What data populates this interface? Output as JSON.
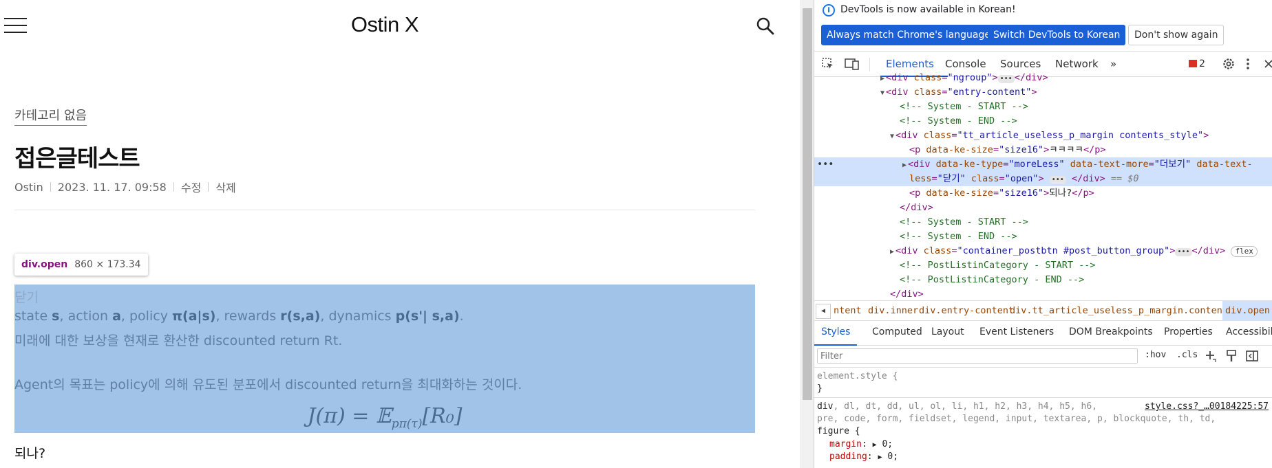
{
  "blog": {
    "site_title": "Ostin X",
    "category": "카테고리 없음",
    "post_title": "접은글테스트",
    "author": "Ostin",
    "date": "2023. 11. 17. 09:58",
    "edit_label": "수정",
    "delete_label": "삭제",
    "tooltip": {
      "selector": "div.open",
      "size": "860 × 173.34"
    },
    "content": {
      "close_label": "닫기",
      "line1_parts": [
        "state ",
        "s",
        ", action ",
        "a",
        ", policy ",
        "π(a|s)",
        ", rewards ",
        "r(s,a)",
        ", dynamics ",
        "p(s'| s,a)",
        "."
      ],
      "line2": "미래에 대한 보상을 현재로 환산한 discounted return Rt.",
      "line3": "Agent의 목표는 policy에 의해 유도된 분포에서 discounted return을 최대화하는 것이다.",
      "formula_left": "J(π) = 𝔼",
      "formula_sub": "pπ(τ)",
      "formula_right": "[R₀]"
    },
    "after_text": "되나?"
  },
  "devtools": {
    "info_text": "DevTools is now available in Korean!",
    "btn_match": "Always match Chrome's language",
    "btn_switch": "Switch DevTools to Korean",
    "btn_dismiss": "Don't show again",
    "tabs": [
      "Elements",
      "Console",
      "Sources",
      "Network"
    ],
    "more_tabs": "»",
    "error_count": "2",
    "dom": {
      "r0_attr": "class",
      "r0_val": "\"ngroup\"",
      "r1_val": "\"entry-content\"",
      "c_start": "<!-- System - START -->",
      "c_end": "<!-- System - END -->",
      "r4_val": "\"tt_article_useless_p_margin contents_style\"",
      "r5_val": "\"size16\"",
      "r5_text": "ㅋㅋㅋㅋ",
      "sel_a1": "data-ke-type",
      "sel_v1": "\"moreLess\"",
      "sel_a2": "data-text-more",
      "sel_v2": "\"더보기\"",
      "sel_a3": "data-text-",
      "sel_a3b": "less",
      "sel_v3": "\"닫기\"",
      "sel_a4": "class",
      "sel_v4": "\"open\"",
      "sel_dollar": "== $0",
      "r7_text": "되나?",
      "r11_val": "\"container_postbtn #post_button_group\"",
      "flex": "flex",
      "c_plc_start": "<!-- PostListinCategory - START -->",
      "c_plc_end": "<!-- PostListinCategory - END -->"
    },
    "breadcrumbs": [
      "ntent",
      "div.inner",
      "div.entry-content",
      "div.tt_article_useless_p_margin.contents_style",
      "div.open"
    ],
    "subtabs": [
      "Styles",
      "Computed",
      "Layout",
      "Event Listeners",
      "DOM Breakpoints",
      "Properties",
      "Accessibility"
    ],
    "filter_placeholder": "Filter",
    "hov": ":hov",
    "cls": ".cls",
    "styles": {
      "element_style": "element.style {",
      "close_brace": "}",
      "selector_line1": "div, dl, dt, dd, ul, ol, li, h1, h2, h3, h4, h5, h6,",
      "selector_line2": "pre, code, form, fieldset, legend, input, textarea, p, blockquote, th, td,",
      "selector_line3": "figure {",
      "source": "style.css?_…00184225:57",
      "margin_prop": "margin",
      "margin_val": "0;",
      "padding_prop": "padding",
      "padding_val": "0;"
    }
  }
}
